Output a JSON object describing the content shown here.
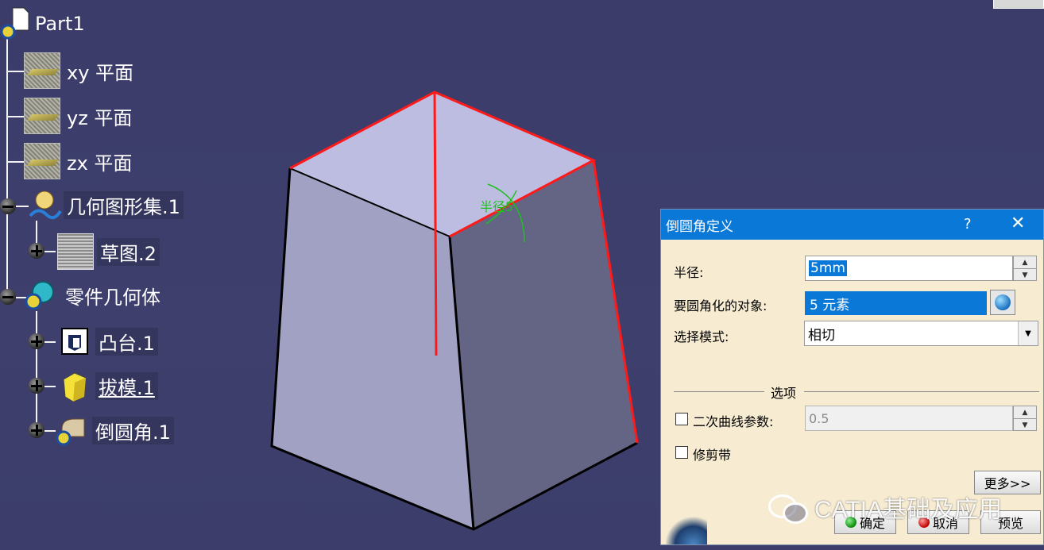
{
  "tree": {
    "root": "Part1",
    "items": [
      {
        "label": "xy 平面"
      },
      {
        "label": "yz 平面"
      },
      {
        "label": "zx 平面"
      },
      {
        "label": "几何图形集.1"
      },
      {
        "label": "草图.2"
      },
      {
        "label": "零件几何体"
      },
      {
        "label": "凸台.1"
      },
      {
        "label": "拔模.1"
      },
      {
        "label": "倒圆角.1"
      }
    ]
  },
  "viewport": {
    "radius_annotation": "半径5"
  },
  "dialog": {
    "title": "倒圆角定义",
    "help": "?",
    "close": "✕",
    "radius_label": "半径:",
    "radius_value": "5mm",
    "objects_label": "要圆角化的对象:",
    "objects_value": "5 元素",
    "mode_label": "选择模式:",
    "mode_value": "相切",
    "options_title": "选项",
    "conic_label": "二次曲线参数:",
    "conic_value": "0.5",
    "trim_label": "修剪带",
    "more_button": "更多>>",
    "ok_button": "确定",
    "cancel_button": "取消",
    "preview_button": "预览"
  },
  "watermark": {
    "text": "CATIA基础及应用"
  },
  "colors": {
    "background": "#3d3e6b",
    "dialog_bg": "#f7ecd2",
    "title_bar": "#0a78d7",
    "edge_highlight": "#ff1a1a",
    "annotation": "#1fbf1f"
  }
}
